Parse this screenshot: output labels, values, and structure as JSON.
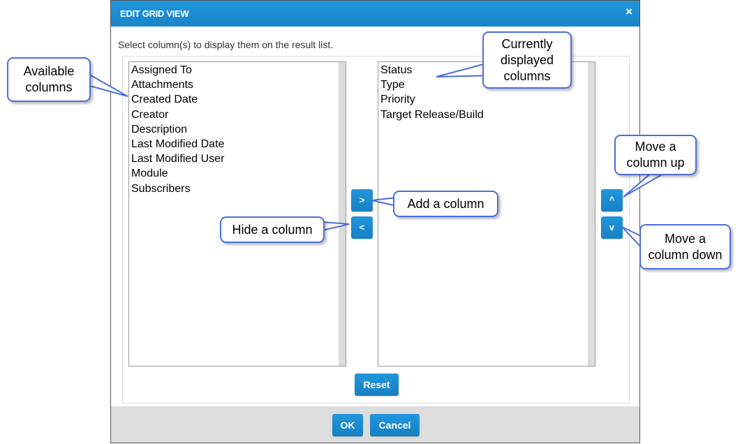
{
  "dialog": {
    "title": "EDIT GRID VIEW",
    "close_icon": "×",
    "instruction": "Select column(s) to display them on the result list.",
    "available_columns": [
      "Assigned To",
      "Attachments",
      "Created Date",
      "Creator",
      "Description",
      "Last Modified Date",
      "Last Modified User",
      "Module",
      "Subscribers"
    ],
    "displayed_columns": [
      "Status",
      "Type",
      "Priority",
      "Target Release/Build"
    ],
    "add_label": ">",
    "remove_label": "<",
    "up_label": "^",
    "down_label": "v",
    "reset_label": "Reset",
    "ok_label": "OK",
    "cancel_label": "Cancel"
  },
  "callouts": {
    "available": "Available columns",
    "displayed": "Currently displayed columns",
    "add": "Add a column",
    "hide": "Hide a column",
    "up": "Move a column up",
    "down": "Move a column down"
  },
  "colors": {
    "accent": "#1e8fd6",
    "callout_border": "#4a6fdc",
    "footer": "#dddddd"
  }
}
